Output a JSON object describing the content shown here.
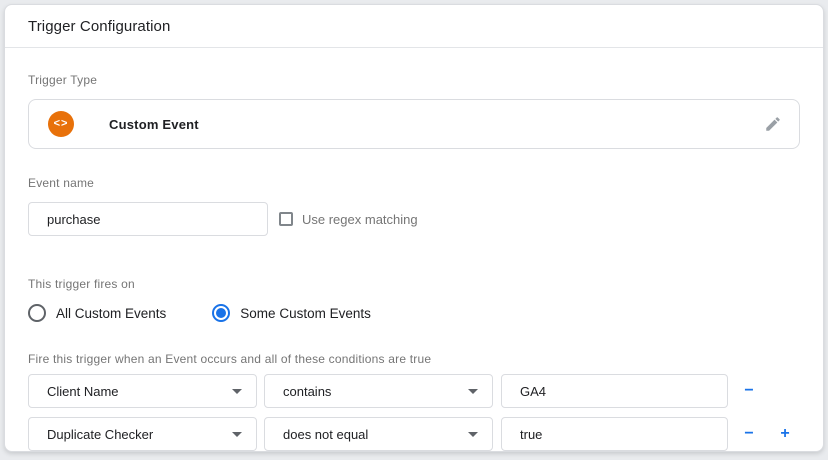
{
  "panel": {
    "title": "Trigger Configuration"
  },
  "trigger_type": {
    "label": "Trigger Type",
    "value": "Custom Event",
    "icon_glyph": "<>",
    "icon_color": "#e8710a"
  },
  "event_name": {
    "label": "Event name",
    "value": "purchase",
    "regex_label": "Use regex matching",
    "regex_checked": false
  },
  "fires_on": {
    "label": "This trigger fires on",
    "options": [
      {
        "label": "All Custom Events",
        "selected": false
      },
      {
        "label": "Some Custom Events",
        "selected": true
      }
    ]
  },
  "conditions": {
    "label": "Fire this trigger when an Event occurs and all of these conditions are true",
    "rows": [
      {
        "variable": "Client Name",
        "operator": "contains",
        "value": "GA4"
      },
      {
        "variable": "Duplicate Checker",
        "operator": "does not equal",
        "value": "true"
      }
    ],
    "remove_label": "−",
    "add_label": "+"
  },
  "colors": {
    "accent_blue": "#1a73e8",
    "icon_orange": "#e8710a",
    "border_gray": "#dadce0"
  }
}
